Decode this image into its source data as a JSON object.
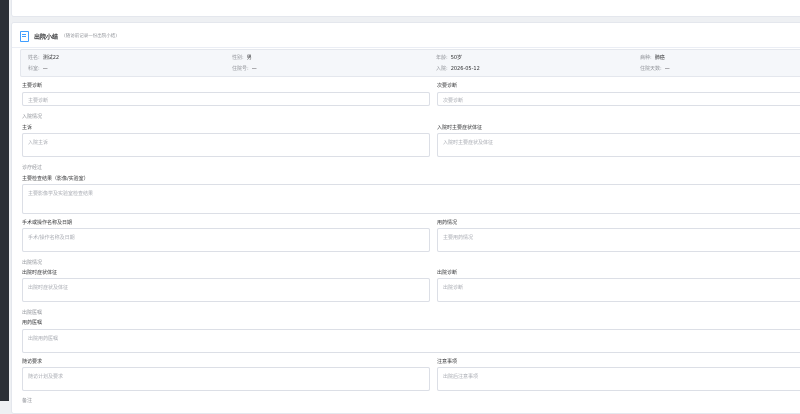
{
  "header": {
    "title": "出院小结",
    "hint": "(随访前记录一份出院小结)"
  },
  "patient": [
    {
      "label": "姓名:",
      "value": "测试22"
    },
    {
      "label": "性别:",
      "value": "男"
    },
    {
      "label": "年龄:",
      "value": "50岁"
    },
    {
      "label": "病种:",
      "value": "肺癌"
    },
    {
      "label": "科室:",
      "value": "—"
    },
    {
      "label": "住院号:",
      "value": "—"
    },
    {
      "label": "入院:",
      "value": "2026-05-12"
    },
    {
      "label": "住院天数:",
      "value": "—"
    }
  ],
  "fields": {
    "main_diag": {
      "label": "主要诊断",
      "placeholder": "主要诊断"
    },
    "sub_diag": {
      "label": "次要诊断",
      "placeholder": "次要诊断"
    },
    "admission_section": "入院情况",
    "complaint": {
      "label": "主诉",
      "placeholder": "入院主诉"
    },
    "admission_symptoms": {
      "label": "入院时主要症状体征",
      "placeholder": "入院时主要症状及体征"
    },
    "treatment_section": "诊疗经过",
    "exam_results": {
      "label": "主要检查结果（影像/实验室）",
      "placeholder": "主要影像学及实验室检查结果"
    },
    "surgery": {
      "label": "手术或操作名称及日期",
      "placeholder": "手术/操作名称及日期"
    },
    "medication": {
      "label": "用药情况",
      "placeholder": "主要用药情况"
    },
    "discharge_section": "出院情况",
    "discharge_symptoms": {
      "label": "出院时症状体征",
      "placeholder": "出院时症状及体征"
    },
    "discharge_diag": {
      "label": "出院诊断",
      "placeholder": "出院诊断"
    },
    "orders_section": "出院医嘱",
    "orders": {
      "label": "用药医嘱",
      "placeholder": "出院用药医嘱"
    },
    "followup": {
      "label": "随访要求",
      "placeholder": "随访计划及要求"
    },
    "notes": {
      "label": "注意事项",
      "placeholder": "出院后注意事项"
    },
    "remarks_section": "备注"
  }
}
